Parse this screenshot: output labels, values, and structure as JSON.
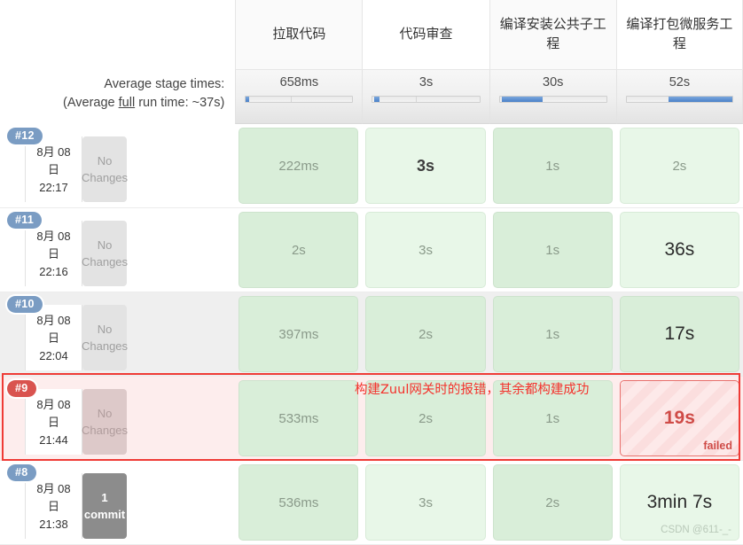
{
  "averages": {
    "line1": "Average stage times:",
    "line2_pre": "(Average ",
    "line2_underline": "full",
    "line2_post": " run time: ~37s)"
  },
  "stages": [
    {
      "name": "拉取代码",
      "avg": "658ms",
      "bar_start_pct": 0,
      "bar_width_pct": 3,
      "mid_pct": 42
    },
    {
      "name": "代码审查",
      "avg": "3s",
      "bar_start_pct": 1,
      "bar_width_pct": 5,
      "mid_pct": 40
    },
    {
      "name": "编译安装公共子工程",
      "avg": "30s",
      "bar_start_pct": 2,
      "bar_width_pct": 38,
      "mid_pct": 0
    },
    {
      "name": "编译打包微服务工程",
      "avg": "52s",
      "bar_start_pct": 40,
      "bar_width_pct": 60,
      "mid_pct": 0
    }
  ],
  "builds": [
    {
      "id": "#12",
      "date": "8月 08",
      "day": "日",
      "time": "22:17",
      "changes": "No Changes",
      "state": "normal",
      "row_style": "plain",
      "cells": [
        {
          "value": "222ms",
          "style": "success",
          "status": "ok"
        },
        {
          "value": "3s",
          "style": "success light",
          "status": "ok",
          "emphasis": "mid"
        },
        {
          "value": "1s",
          "style": "success",
          "status": "ok"
        },
        {
          "value": "2s",
          "style": "success light",
          "status": "ok"
        }
      ]
    },
    {
      "id": "#11",
      "date": "8月 08",
      "day": "日",
      "time": "22:16",
      "changes": "No Changes",
      "state": "normal",
      "row_style": "plain",
      "cells": [
        {
          "value": "2s",
          "style": "success",
          "status": "ok"
        },
        {
          "value": "3s",
          "style": "success light",
          "status": "ok"
        },
        {
          "value": "1s",
          "style": "success",
          "status": "ok"
        },
        {
          "value": "36s",
          "style": "success light",
          "status": "ok",
          "emphasis": "dark"
        }
      ]
    },
    {
      "id": "#10",
      "date": "8月 08",
      "day": "日",
      "time": "22:04",
      "changes": "No Changes",
      "state": "normal",
      "row_style": "hovered",
      "cells": [
        {
          "value": "397ms",
          "style": "success",
          "status": "ok"
        },
        {
          "value": "2s",
          "style": "success",
          "status": "ok"
        },
        {
          "value": "1s",
          "style": "success",
          "status": "ok"
        },
        {
          "value": "17s",
          "style": "success",
          "status": "ok",
          "emphasis": "dark"
        }
      ]
    },
    {
      "id": "#9",
      "date": "8月 08",
      "day": "日",
      "time": "21:44",
      "changes": "No Changes",
      "state": "failed",
      "row_style": "failrow",
      "cells": [
        {
          "value": "533ms",
          "style": "success",
          "status": "ok"
        },
        {
          "value": "2s",
          "style": "success",
          "status": "ok"
        },
        {
          "value": "1s",
          "style": "success",
          "status": "ok"
        },
        {
          "value": "19s",
          "style": "failed",
          "status": "failed",
          "tag": "failed"
        }
      ]
    },
    {
      "id": "#8",
      "date": "8月 08",
      "day": "日",
      "time": "21:38",
      "changes": "1 commit",
      "changes_count": "1",
      "changes_word": "commit",
      "state": "normal",
      "row_style": "plain",
      "cells": [
        {
          "value": "536ms",
          "style": "success",
          "status": "ok"
        },
        {
          "value": "3s",
          "style": "success light",
          "status": "ok"
        },
        {
          "value": "2s",
          "style": "success",
          "status": "ok"
        },
        {
          "value": "3min 7s",
          "style": "success light",
          "status": "ok",
          "emphasis": "dark",
          "watermark": "CSDN @611-_-"
        }
      ]
    }
  ],
  "annotation": {
    "text": "构建Zuul网关时的报错，其余都构建成功",
    "color": "#f4322c"
  },
  "colors": {
    "accent_blue": "#4a80c8",
    "fail_red": "#d9534f",
    "highlight_red": "#ef3b36",
    "success_green": "#d9eed9",
    "badge_blue": "#7a9cc3"
  }
}
